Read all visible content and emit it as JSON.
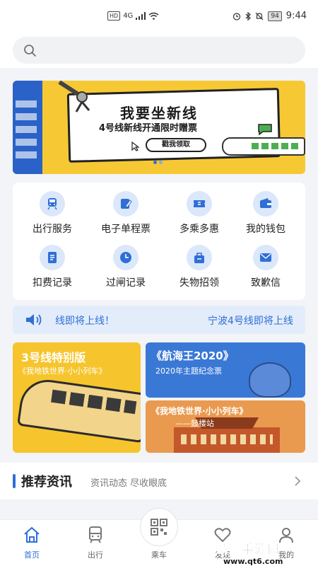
{
  "status_bar": {
    "network": "4G",
    "hd": "HD",
    "battery": "94",
    "time": "9:44"
  },
  "search": {
    "placeholder": ""
  },
  "banner": {
    "title": "我要坐新线",
    "subtitle": "4号线新线开通限时赠票",
    "button_label": "戳我领取",
    "active_page": 1,
    "page_count": 2
  },
  "services": [
    {
      "label": "出行服务",
      "icon": "metro-train-icon"
    },
    {
      "label": "电子单程票",
      "icon": "ticket-edit-icon"
    },
    {
      "label": "多乘多惠",
      "icon": "coupon-icon"
    },
    {
      "label": "我的钱包",
      "icon": "wallet-icon"
    },
    {
      "label": "扣费记录",
      "icon": "document-icon"
    },
    {
      "label": "过闸记录",
      "icon": "clock-icon"
    },
    {
      "label": "失物招领",
      "icon": "lost-found-icon"
    },
    {
      "label": "致歉信",
      "icon": "mail-icon"
    }
  ],
  "notice": {
    "text_1": "线即将上线！",
    "text_2": "宁波4号线即将上线"
  },
  "promos": {
    "p1_title": "3号线特别版",
    "p1_sub": "《我地铁世界·小小列车》",
    "p2_title": "《航海王2020》",
    "p2_sub": "2020年主题纪念票",
    "p3_title": "《我地铁世界·小小列车》",
    "p3_sub": "——鼓楼站"
  },
  "news": {
    "title": "推荐资讯",
    "subtitle": "资讯动态 尽收眼底"
  },
  "tabbar": {
    "home": "首页",
    "trip": "出行",
    "ride": "乘车",
    "discover": "发现",
    "mine": "我的"
  },
  "watermark": {
    "text": "蜻蜓手游网",
    "url": "www.qt6.com"
  },
  "colors": {
    "accent": "#2f6fd6",
    "banner_yellow": "#f6c934",
    "notice_bg": "#e3ecfa",
    "icon_bg": "#dbe7fb"
  }
}
